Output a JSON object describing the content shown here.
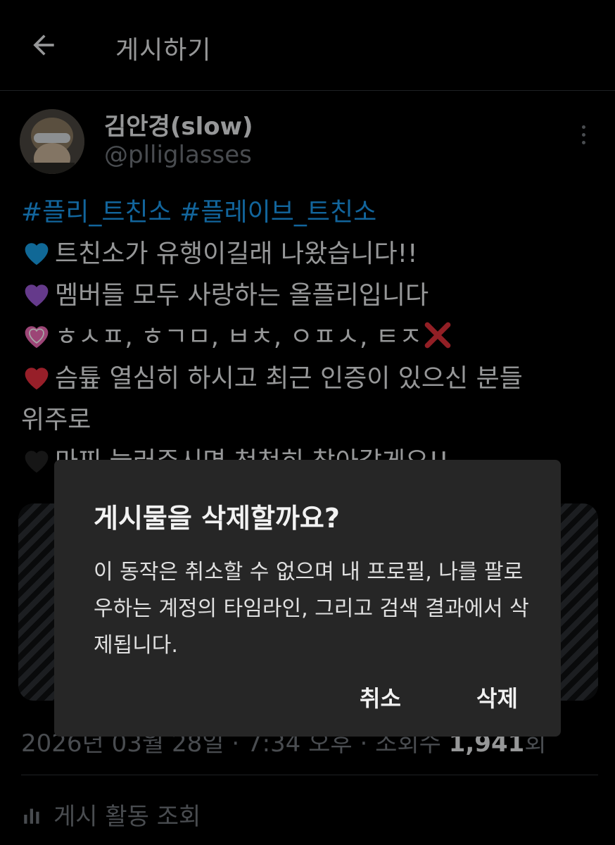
{
  "header": {
    "title": "게시하기"
  },
  "post": {
    "author_name": "김안경(slow)",
    "author_handle": "@plliglasses",
    "hashtags": [
      "#플리_트친소",
      "#플레이브_트친소"
    ],
    "lines": [
      {
        "emoji": "blue-heart",
        "color": "#1aa0e6",
        "text": "트친소가 유행이길래 나왔습니다!!"
      },
      {
        "emoji": "purple-heart",
        "color": "#9b59d6",
        "text": "멤버들 모두 사랑하는 올플리입니다"
      },
      {
        "emoji": "pink-heart",
        "color": "#f06ab6",
        "text": "ㅎㅅㅍ, ㅎㄱㅁ, ㅂㅊ, ㅇㅍㅅ, ㅌㅈ"
      },
      {
        "emoji": "red-heart",
        "color": "#e8303f",
        "text": "슴튶 열심히 하시고 최근 인증이 있으신 분들"
      },
      {
        "emoji": "",
        "color": "",
        "text": "위주로"
      },
      {
        "emoji": "black-heart",
        "color": "#222222",
        "text": "마찌 눌러주시면 천천히 찾아갈게요!!"
      }
    ],
    "cross_emoji": "red-x",
    "timestamp_meta": "2026년 03월 28일 · 7:34 오후 · 조회수",
    "view_count": "1,941",
    "view_suffix": "회",
    "activity_label": "게시 활동 조회"
  },
  "dialog": {
    "title": "게시물을 삭제할까요?",
    "message": "이 동작은 취소할 수 없으며 내 프로필, 나를 팔로우하는 계정의 타임라인, 그리고 검색 결과에서 삭제됩니다.",
    "cancel_label": "취소",
    "delete_label": "삭제"
  }
}
